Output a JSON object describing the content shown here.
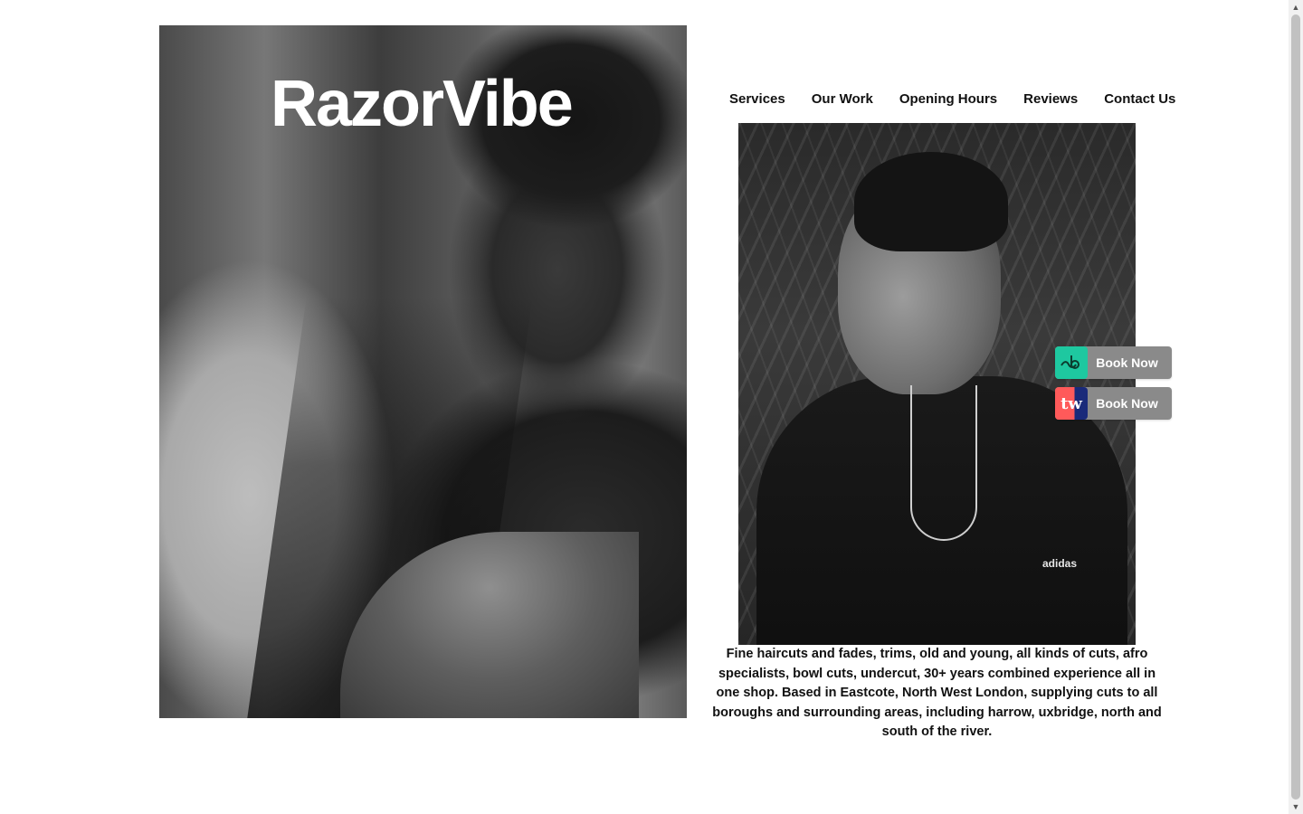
{
  "brand": {
    "name": "RazorVibe"
  },
  "nav": {
    "items": [
      {
        "label": "Services"
      },
      {
        "label": "Our Work"
      },
      {
        "label": "Opening Hours"
      },
      {
        "label": "Reviews"
      },
      {
        "label": "Contact Us"
      }
    ]
  },
  "about": {
    "text": "Fine haircuts and fades, trims, old and young, all kinds of cuts, afro specialists, bowl cuts, undercut, 30+ years combined experience all in one shop. Based in Eastcote, North West London, supplying cuts to all boroughs and surrounding areas, including harrow, uxbridge, north and south of the river."
  },
  "booking": {
    "buttons": [
      {
        "label": "Book Now",
        "icon": "booksy-icon",
        "accent": "#1ec8a0"
      },
      {
        "label": "Book Now",
        "icon": "treatwell-icon",
        "badge_text": "tw",
        "accent": "#ff5a5a"
      }
    ]
  },
  "images": {
    "hero_logo_print": "adidas"
  },
  "colors": {
    "background": "#ffffff",
    "text": "#111111",
    "booking_button_bg": "#8a8a8a"
  }
}
